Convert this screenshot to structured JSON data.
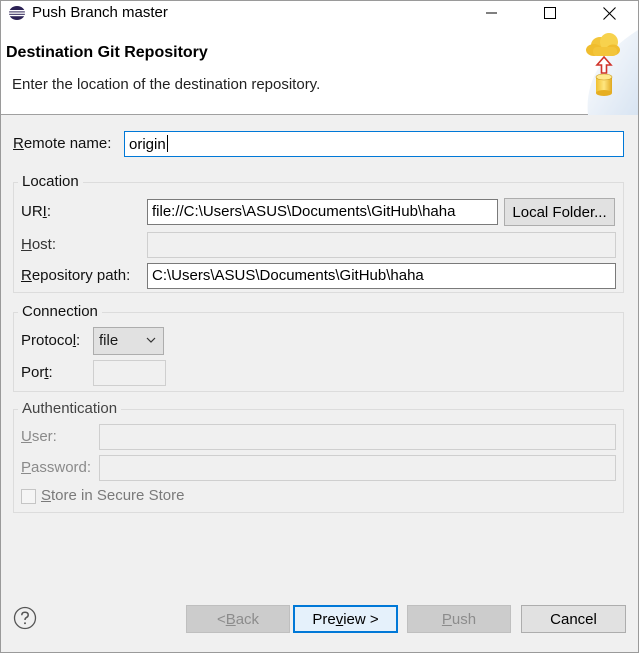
{
  "window": {
    "title": "Push Branch master"
  },
  "banner": {
    "title": "Destination Git Repository",
    "description": "Enter the location of the destination repository."
  },
  "remote": {
    "label_pre": "",
    "label_key": "R",
    "label_post": "emote name:",
    "value": "origin"
  },
  "location": {
    "title": "Location",
    "uri_label_pre": "UR",
    "uri_label_key": "I",
    "uri_label_post": ":",
    "uri_value": "file://C:\\Users\\ASUS\\Documents\\GitHub\\haha",
    "local_folder_button": "Local Folder...",
    "host_label_key": "H",
    "host_label_post": "ost:",
    "host_value": "",
    "repo_label_key": "R",
    "repo_label_post": "epository path:",
    "repo_value": "C:\\Users\\ASUS\\Documents\\GitHub\\haha"
  },
  "connection": {
    "title": "Connection",
    "protocol_label_pre": "Protoco",
    "protocol_label_key": "l",
    "protocol_label_post": ":",
    "protocol_value": "file",
    "port_label_pre": "Por",
    "port_label_key": "t",
    "port_label_post": ":",
    "port_value": ""
  },
  "authentication": {
    "title": "Authentication",
    "user_label_key": "U",
    "user_label_post": "ser:",
    "password_label_key": "P",
    "password_label_post": "assword:",
    "store_label_key": "S",
    "store_label_post": "tore in Secure Store"
  },
  "footer": {
    "back_pre": "< ",
    "back_key": "B",
    "back_post": "ack",
    "preview_pre": "Pre",
    "preview_key": "v",
    "preview_post": "iew >",
    "push_key": "P",
    "push_post": "ush",
    "cancel": "Cancel"
  },
  "colors": {
    "focus": "#0078d7",
    "disabled_text": "#8c8c8c"
  }
}
